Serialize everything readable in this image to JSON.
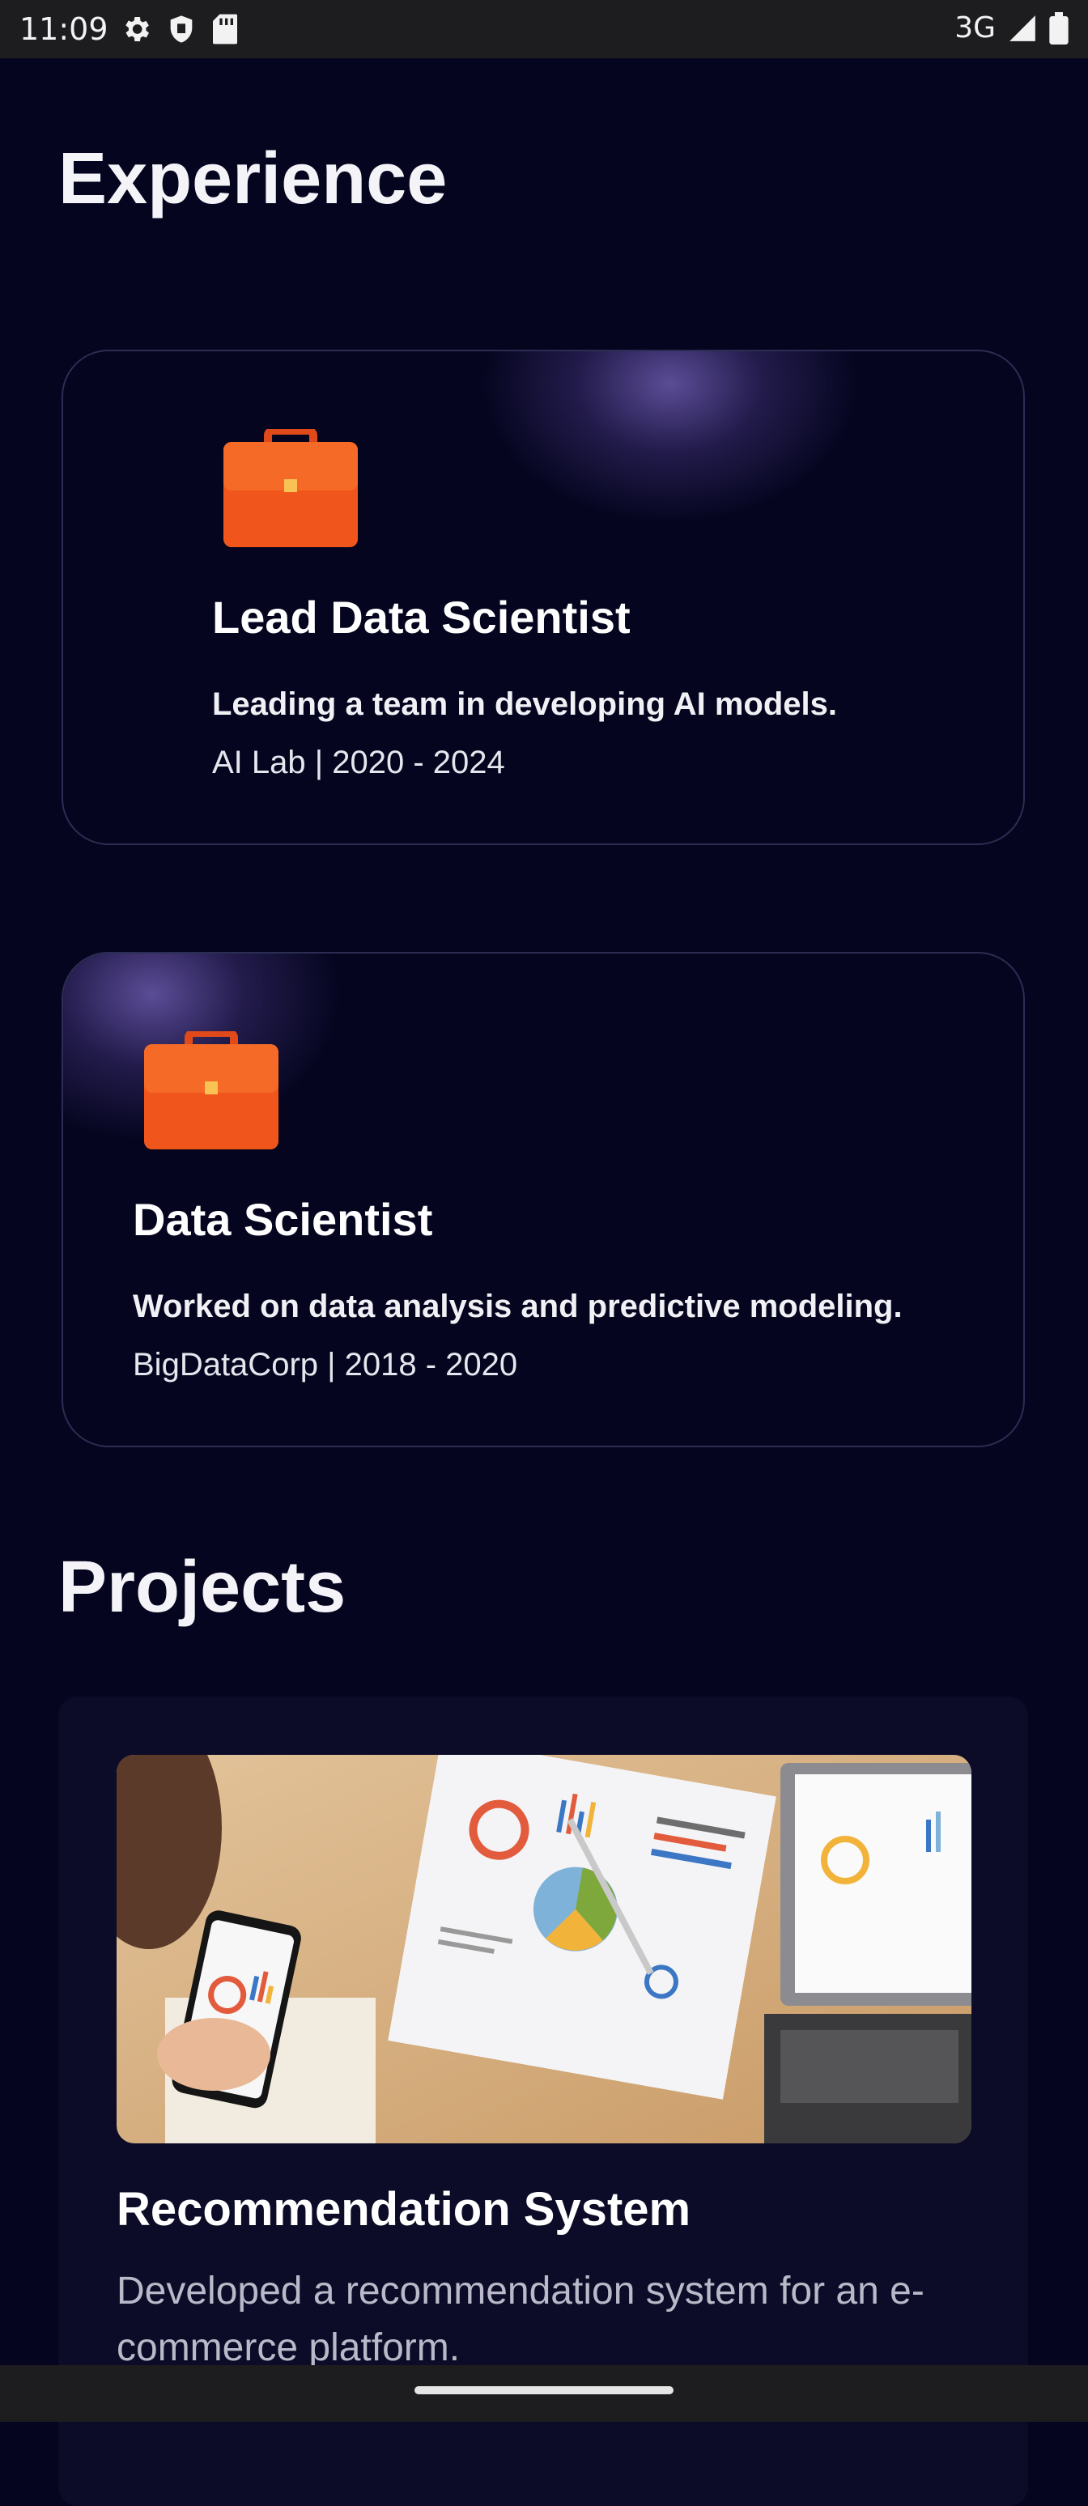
{
  "status_bar": {
    "time": "11:09",
    "network": "3G",
    "icons": [
      "gear-icon",
      "shield-icon",
      "sd-card-icon",
      "signal-icon",
      "battery-icon"
    ]
  },
  "experience": {
    "title": "Experience",
    "items": [
      {
        "icon": "briefcase-icon",
        "title": "Lead Data Scientist",
        "description": "Leading a team in developing AI models.",
        "meta": "AI Lab | 2020 - 2024"
      },
      {
        "icon": "briefcase-icon",
        "title": "Data Scientist",
        "description": "Worked on data analysis and predictive modeling.",
        "meta": "BigDataCorp | 2018 - 2020"
      }
    ]
  },
  "projects": {
    "title": "Projects",
    "items": [
      {
        "image": "data-analysis-photo",
        "title": "Recommendation System",
        "description": "Developed a recommendation system for an e-commerce platform."
      }
    ]
  },
  "colors": {
    "background": "#050520",
    "card_border": "#2c2d52",
    "briefcase": "#f0561c",
    "muted_text": "#b9b9c9"
  }
}
